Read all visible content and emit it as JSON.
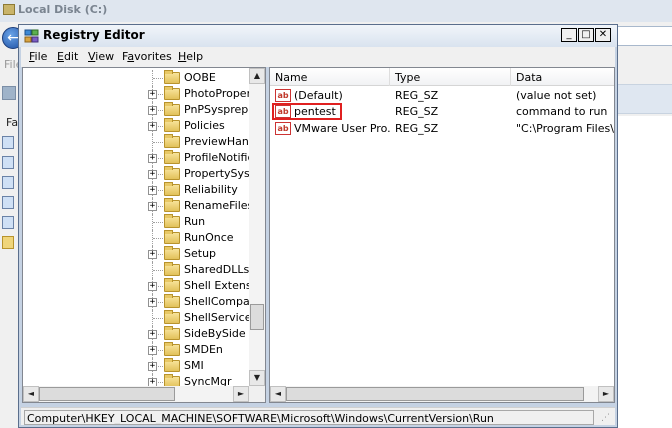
{
  "background_window": {
    "title": "Local Disk (C:)",
    "back_label": "←",
    "menu_file": "File",
    "favorites_label": "Fa"
  },
  "regedit": {
    "title": "Registry Editor",
    "controls": {
      "minimize": "_",
      "maximize": "□",
      "close": "✕"
    },
    "menu": [
      {
        "pre": "",
        "u": "F",
        "post": "ile"
      },
      {
        "pre": "",
        "u": "E",
        "post": "dit"
      },
      {
        "pre": "",
        "u": "V",
        "post": "iew"
      },
      {
        "pre": "F",
        "u": "a",
        "post": "vorites"
      },
      {
        "pre": "",
        "u": "H",
        "post": "elp"
      }
    ],
    "tree": {
      "items": [
        {
          "label": "OOBE",
          "expandable": false
        },
        {
          "label": "PhotoPropert",
          "expandable": true
        },
        {
          "label": "PnPSysprep",
          "expandable": true
        },
        {
          "label": "Policies",
          "expandable": true
        },
        {
          "label": "PreviewHandl",
          "expandable": false
        },
        {
          "label": "ProfileNotifica",
          "expandable": true
        },
        {
          "label": "PropertySyste",
          "expandable": true
        },
        {
          "label": "Reliability",
          "expandable": true
        },
        {
          "label": "RenameFiles",
          "expandable": true
        },
        {
          "label": "Run",
          "expandable": false
        },
        {
          "label": "RunOnce",
          "expandable": false
        },
        {
          "label": "Setup",
          "expandable": true
        },
        {
          "label": "SharedDLLs",
          "expandable": false
        },
        {
          "label": "Shell Extensio",
          "expandable": true
        },
        {
          "label": "ShellCompatib",
          "expandable": true
        },
        {
          "label": "ShellServiceO",
          "expandable": false
        },
        {
          "label": "SideBySide",
          "expandable": true
        },
        {
          "label": "SMDEn",
          "expandable": true
        },
        {
          "label": "SMI",
          "expandable": true
        },
        {
          "label": "SyncMgr",
          "expandable": true
        }
      ],
      "expand_glyph": "+"
    },
    "list": {
      "columns": [
        "Name",
        "Type",
        "Data"
      ],
      "icon_text": "ab",
      "rows": [
        {
          "name": "(Default)",
          "type": "REG_SZ",
          "data": "(value not set)",
          "highlighted": false
        },
        {
          "name": "pentest",
          "type": "REG_SZ",
          "data": "command to run",
          "highlighted": true
        },
        {
          "name": "VMware User Pro...",
          "type": "REG_SZ",
          "data": "\"C:\\Program Files\\V",
          "highlighted": false
        }
      ]
    },
    "scroll": {
      "up": "▲",
      "down": "▼",
      "left": "◄",
      "right": "►"
    },
    "status": "Computer\\HKEY_LOCAL_MACHINE\\SOFTWARE\\Microsoft\\Windows\\CurrentVersion\\Run",
    "highlight_color": "#e02020"
  }
}
